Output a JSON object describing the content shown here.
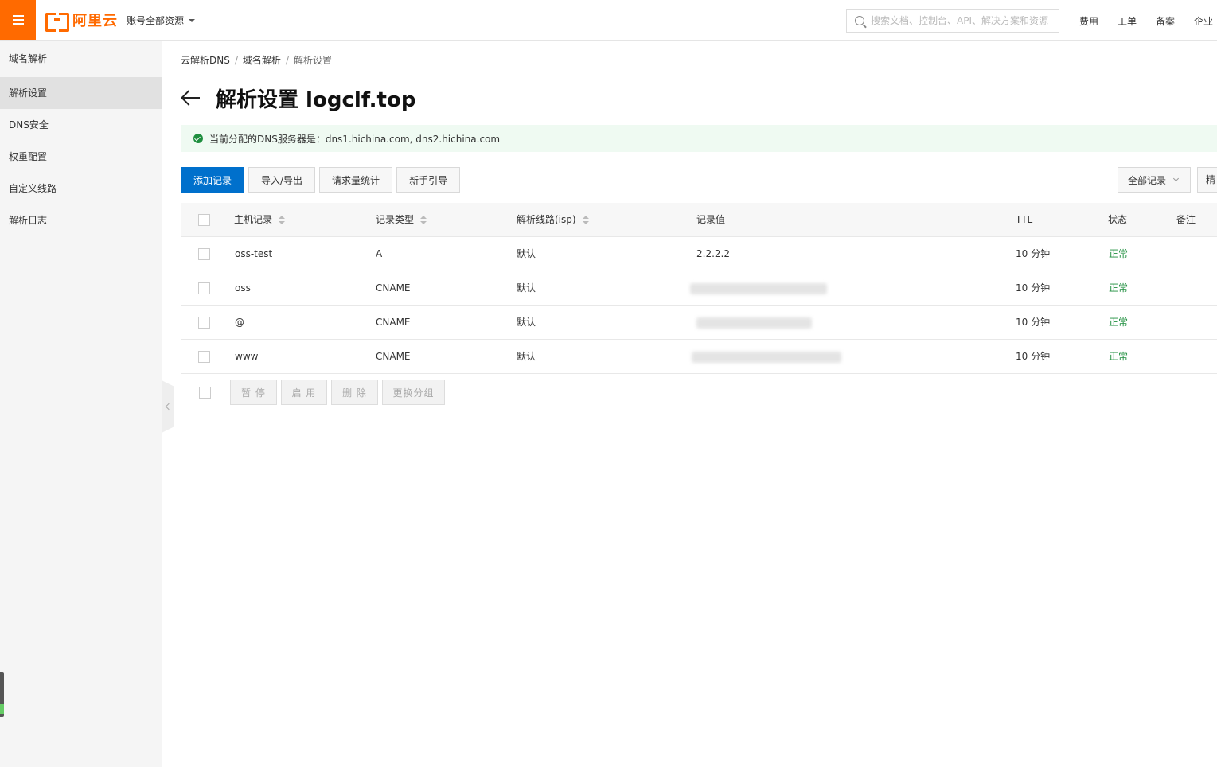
{
  "header": {
    "logo_text": "阿里云",
    "account_scope": "账号全部资源",
    "search_placeholder": "搜索文档、控制台、API、解决方案和资源",
    "links": [
      "费用",
      "工单",
      "备案",
      "企业"
    ]
  },
  "sidebar": {
    "items": [
      {
        "label": "域名解析",
        "active": false
      },
      {
        "label": "解析设置",
        "active": true
      },
      {
        "label": "DNS安全",
        "active": false
      },
      {
        "label": "权重配置",
        "active": false
      },
      {
        "label": "自定义线路",
        "active": false
      },
      {
        "label": "解析日志",
        "active": false
      }
    ]
  },
  "breadcrumb": {
    "items": [
      "云解析DNS",
      "域名解析",
      "解析设置"
    ],
    "separator": "/"
  },
  "page": {
    "title": "解析设置 logclf.top"
  },
  "notice": {
    "text": "当前分配的DNS服务器是：dns1.hichina.com, dns2.hichina.com"
  },
  "toolbar": {
    "add_record": "添加记录",
    "import_export": "导入/导出",
    "request_stats": "请求量统计",
    "guide": "新手引导",
    "filter_select": "全部记录",
    "cut_button": "精"
  },
  "table": {
    "columns": {
      "host": "主机记录",
      "type": "记录类型",
      "line": "解析线路(isp)",
      "value": "记录值",
      "ttl": "TTL",
      "status": "状态",
      "remark": "备注"
    },
    "rows": [
      {
        "host": "oss-test",
        "type": "A",
        "line": "默认",
        "value": "2.2.2.2",
        "ttl": "10 分钟",
        "status": "正常",
        "remark": ""
      },
      {
        "host": "oss",
        "type": "CNAME",
        "line": "默认",
        "value": "",
        "ttl": "10 分钟",
        "status": "正常",
        "remark": ""
      },
      {
        "host": "@",
        "type": "CNAME",
        "line": "默认",
        "value": "",
        "ttl": "10 分钟",
        "status": "正常",
        "remark": ""
      },
      {
        "host": "www",
        "type": "CNAME",
        "line": "默认",
        "value": "",
        "ttl": "10 分钟",
        "status": "正常",
        "remark": ""
      }
    ]
  },
  "bulk_actions": {
    "pause": "暂 停",
    "enable": "启 用",
    "delete": "删 除",
    "change_group": "更换分组"
  },
  "colors": {
    "brand_orange": "#ff6a00",
    "primary_blue": "#0070cc",
    "status_green": "#1e8e3e",
    "notice_bg": "#effaf2"
  }
}
